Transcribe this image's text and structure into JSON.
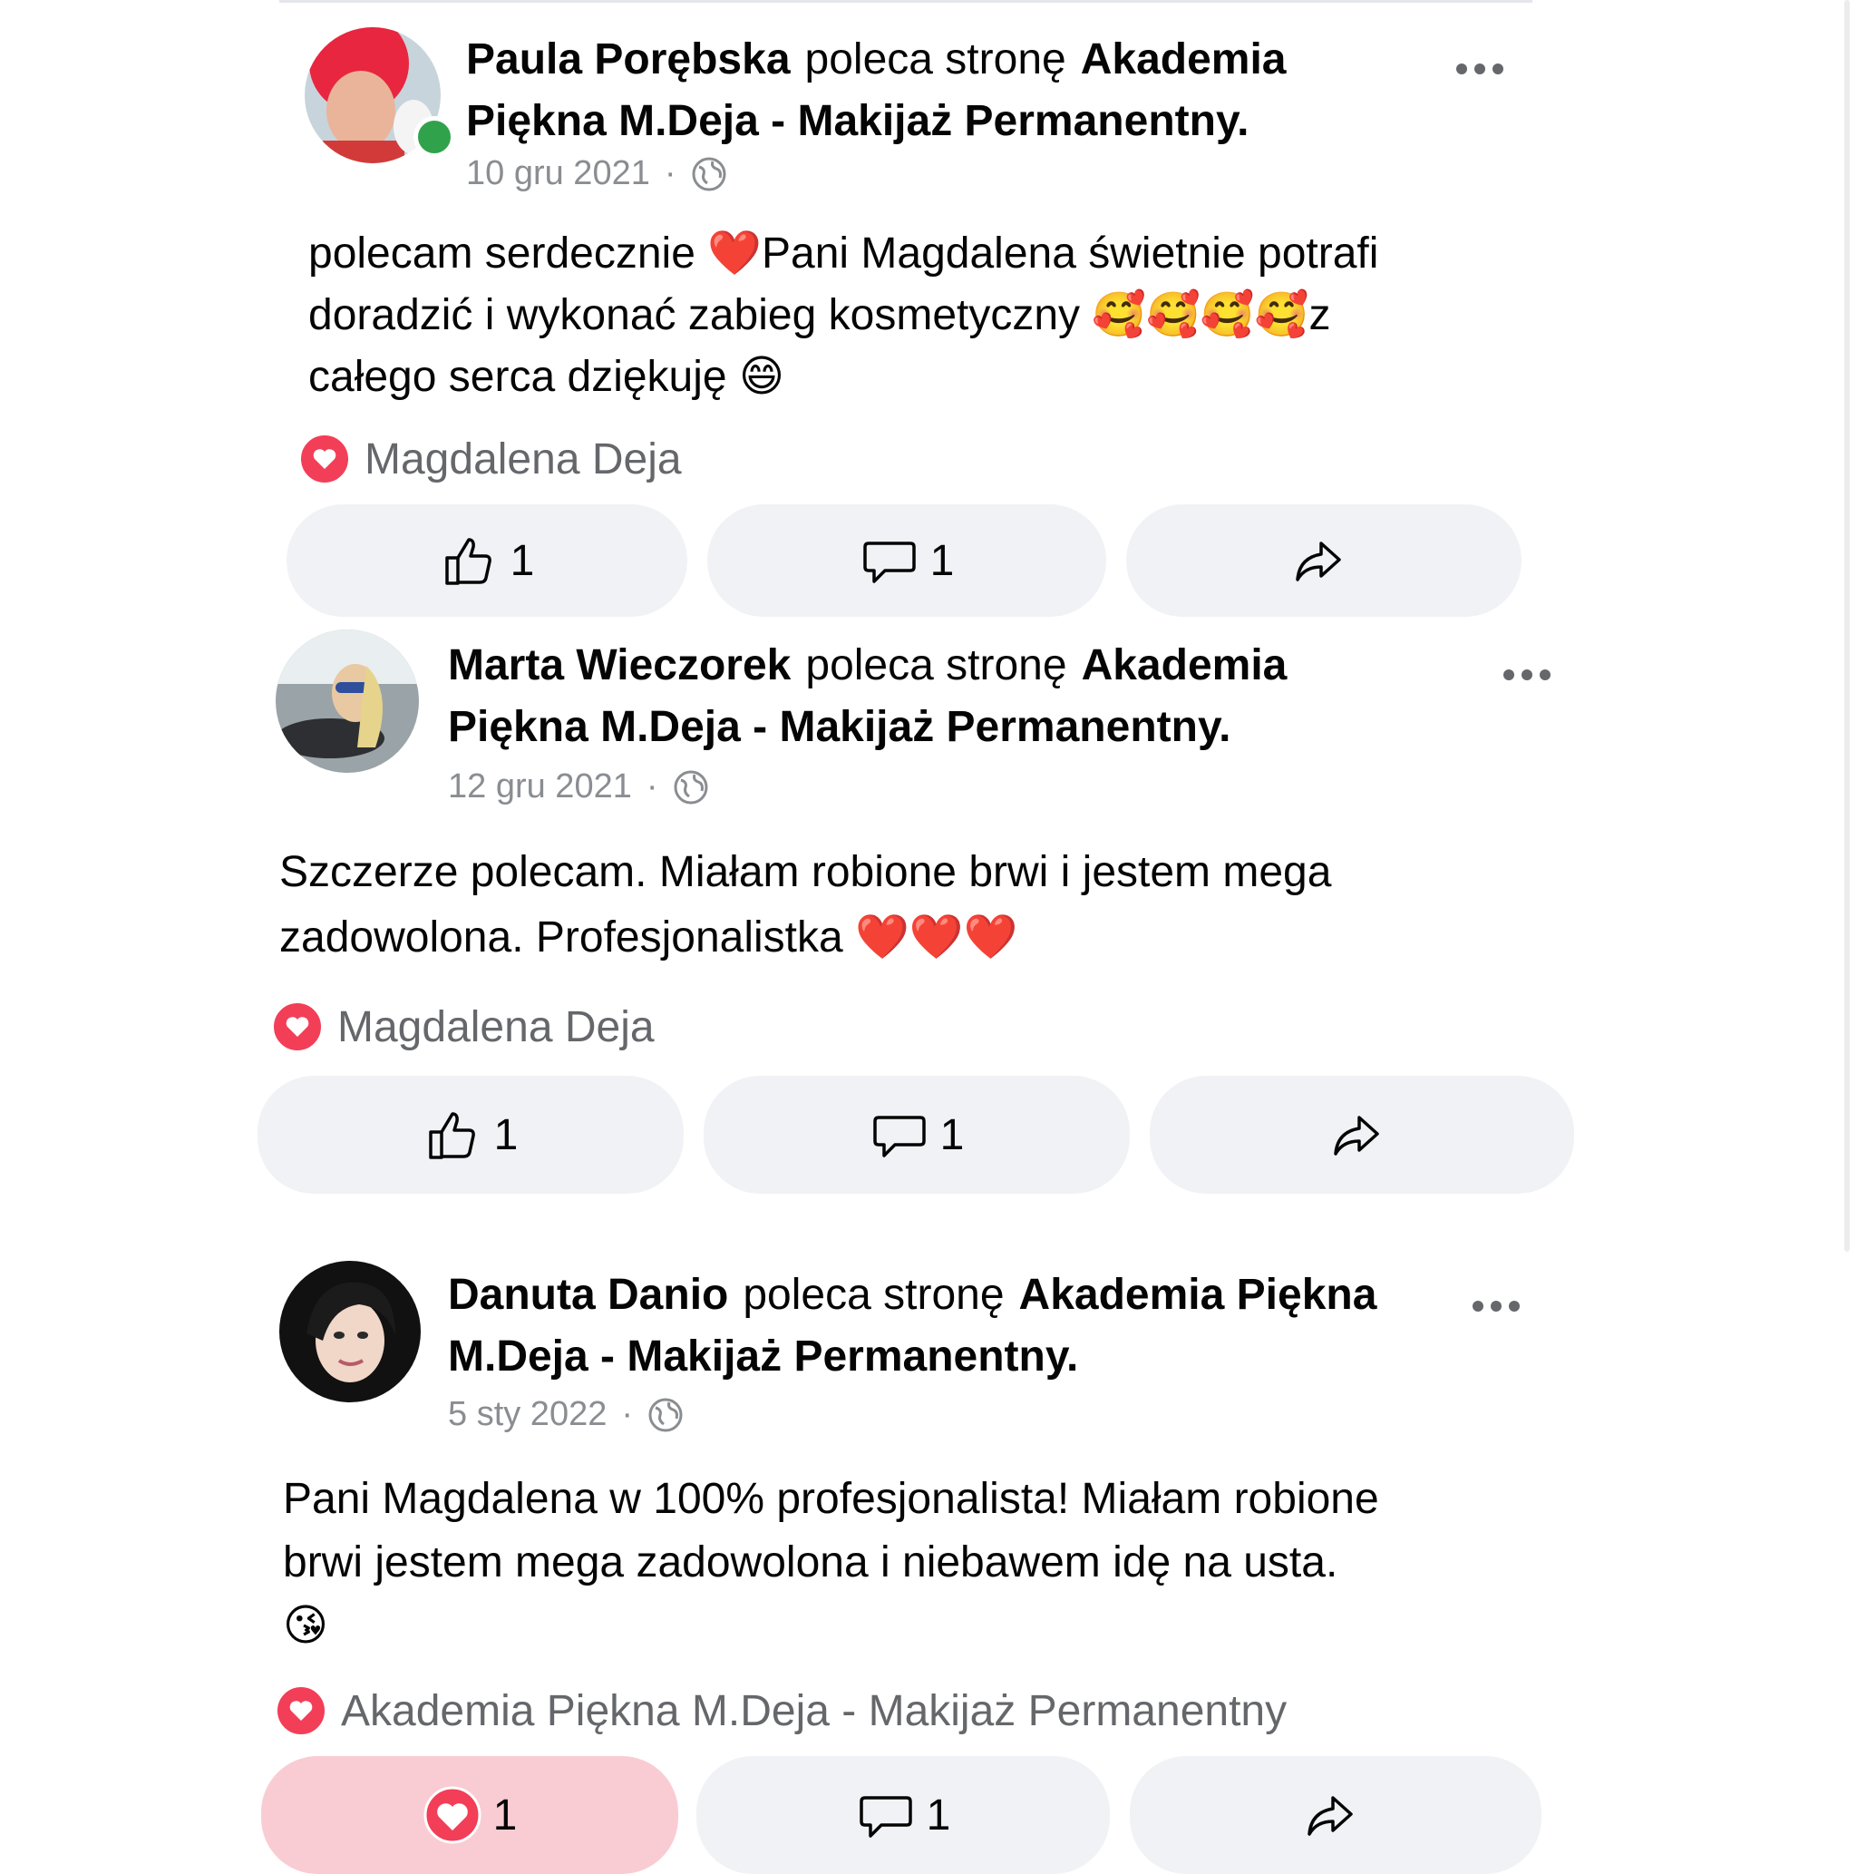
{
  "colors": {
    "bg": "#ffffff",
    "button_bg": "#f0f2f5",
    "liked_bg": "#f9ccd3",
    "heart": "#f33e58",
    "online": "#31a24c",
    "meta_grey": "#8a8d91"
  },
  "posts": [
    {
      "author": "Paula Porębska",
      "verb": "poleca stronę",
      "page": "Akademia Piękna M.Deja  - Makijaż Permanentny.",
      "date": "10 gru 2021",
      "separator": "·",
      "text_lines": [
        "polecam serdecznie ❤️Pani Magdalena świetnie potrafi",
        "doradzić i wykonać zabieg kosmetyczny 🥰🥰🥰🥰z",
        "całego serca dziękuję 😄"
      ],
      "reacted_by": "Magdalena Deja",
      "like_count": "1",
      "comment_count": "1",
      "avatar_icon": "avatar-photo",
      "online": true
    },
    {
      "author": "Marta Wieczorek",
      "verb": "poleca stronę",
      "page": "Akademia Piękna M.Deja  - Makijaż Permanentny.",
      "date": "12 gru 2021",
      "separator": "·",
      "text_lines": [
        "Szczerze polecam. Miałam robione brwi i jestem mega",
        "zadowolona. Profesjonalistka ❤️❤️❤️"
      ],
      "reacted_by": "Magdalena Deja",
      "like_count": "1",
      "comment_count": "1",
      "avatar_icon": "avatar-photo",
      "online": false
    },
    {
      "author": "Danuta Danio",
      "verb": "poleca stronę",
      "page": "Akademia Piękna M.Deja  - Makijaż Permanentny.",
      "date": "5 sty 2022",
      "separator": "·",
      "text_lines": [
        "Pani Magdalena w 100% profesjonalista! Miałam robione",
        "brwi jestem mega zadowolona i niebawem idę na usta.",
        "😘"
      ],
      "reacted_by": "Akademia Piękna M.Deja  - Makijaż Permanentny",
      "like_count": "1",
      "comment_count": "1",
      "avatar_icon": "avatar-photo",
      "online": false,
      "liked": true
    }
  ]
}
